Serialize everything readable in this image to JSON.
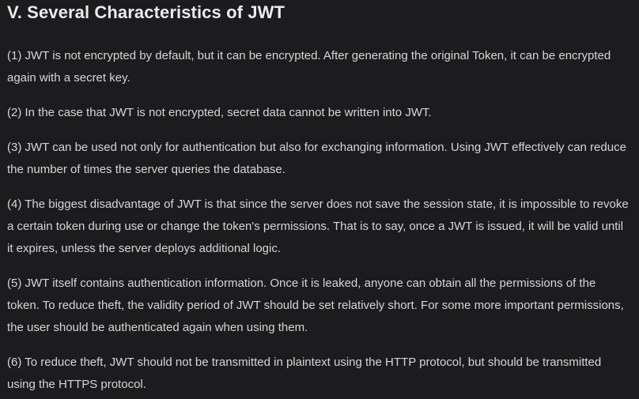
{
  "document": {
    "heading": "V. Several Characteristics of JWT",
    "paragraphs": [
      "(1) JWT is not encrypted by default, but it can be encrypted. After generating the original Token, it can be encrypted again with a secret key.",
      "(2) In the case that JWT is not encrypted, secret data cannot be written into JWT.",
      "(3) JWT can be used not only for authentication but also for exchanging information. Using JWT effectively can reduce the number of times the server queries the database.",
      "(4) The biggest disadvantage of JWT is that since the server does not save the session state, it is impossible to revoke a certain token during use or change the token's permissions. That is to say, once a JWT is issued, it will be valid until it expires, unless the server deploys additional logic.",
      "(5) JWT itself contains authentication information. Once it is leaked, anyone can obtain all the permissions of the token. To reduce theft, the validity period of JWT should be set relatively short. For some more important permissions, the user should be authenticated again when using them.",
      "(6) To reduce theft, JWT should not be transmitted in plaintext using the HTTP protocol, but should be transmitted using the HTTPS protocol."
    ]
  },
  "colors": {
    "background": "#1c1c1e",
    "heading": "#ececec",
    "text": "#d6d6d6"
  }
}
